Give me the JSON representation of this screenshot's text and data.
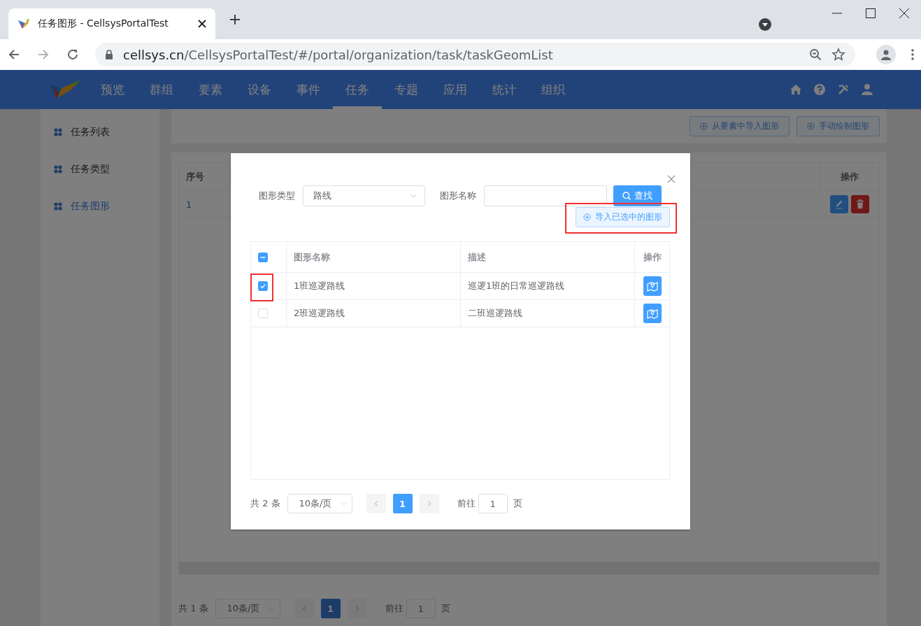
{
  "browser": {
    "tab_title": "任务图形 - CellsysPortalTest",
    "url_host": "cellsys.cn",
    "url_path": "/CellsysPortalTest/#/portal/organization/task/taskGeomList"
  },
  "nav": {
    "items": [
      {
        "label": "预览",
        "selected": false
      },
      {
        "label": "群组",
        "selected": false
      },
      {
        "label": "要素",
        "selected": false
      },
      {
        "label": "设备",
        "selected": false
      },
      {
        "label": "事件",
        "selected": false
      },
      {
        "label": "任务",
        "selected": true
      },
      {
        "label": "专题",
        "selected": false
      },
      {
        "label": "应用",
        "selected": false
      },
      {
        "label": "统计",
        "selected": false
      },
      {
        "label": "组织",
        "selected": false
      }
    ]
  },
  "sidebar": {
    "items": [
      {
        "label": "任务列表",
        "selected": false
      },
      {
        "label": "任务类型",
        "selected": false
      },
      {
        "label": "任务图形",
        "selected": true
      }
    ]
  },
  "toolbar": {
    "buttons": [
      "从要素中导入图形",
      "手动绘制图形"
    ]
  },
  "table": {
    "columns": [
      "序号",
      "操作"
    ],
    "rows": [
      {
        "index": "1"
      }
    ]
  },
  "pagination": {
    "total": "共 1 条",
    "page_size": "10条/页",
    "pages": [
      {
        "label": "1",
        "selected": true
      }
    ],
    "goto_label": "前往",
    "goto_value": "1",
    "goto_suffix": "页"
  },
  "dialog": {
    "type_label": "图形类型",
    "type_value": "路线",
    "name_label": "图形名称",
    "search_button": "查找",
    "import_button": {
      "label": "导入已选中的图形",
      "highlighted": true
    },
    "columns": [
      "图形名称",
      "描述",
      "操作"
    ],
    "header_checkbox": {
      "checked": false,
      "indeterminate": true
    },
    "rows": [
      {
        "name": "1班巡逻路线",
        "description": "巡逻1班的日常巡逻路线",
        "checked": true,
        "highlighted": true
      },
      {
        "name": "2班巡逻路线",
        "description": "二班巡逻路线",
        "checked": false,
        "highlighted": false
      }
    ],
    "pagination": {
      "total": "共 2 条",
      "page_size": "10条/页",
      "pages": [
        {
          "label": "1",
          "selected": true
        }
      ],
      "goto_label": "前往",
      "goto_value": "1",
      "goto_suffix": "页"
    }
  }
}
